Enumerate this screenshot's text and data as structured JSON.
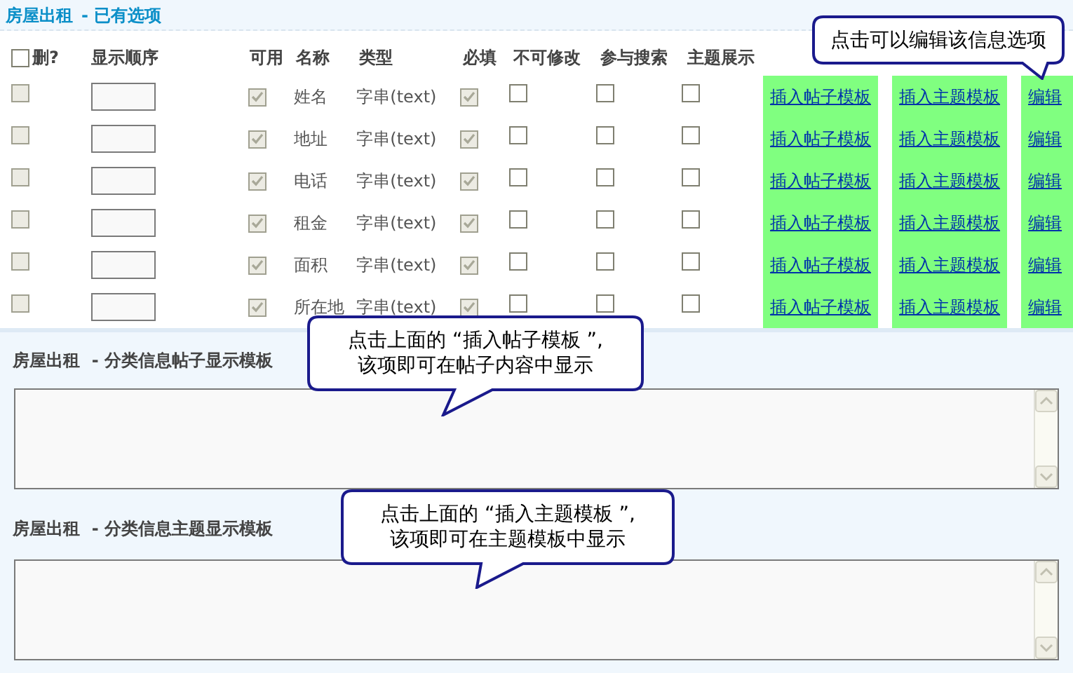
{
  "title": {
    "main": "房屋出租",
    "sub": "- 已有选项"
  },
  "columns": [
    "删?",
    "显示顺序",
    "可用",
    "名称",
    "类型",
    "必填",
    "不可修改",
    "参与搜索",
    "主题展示"
  ],
  "header_delete_checkbox": {
    "checked": false,
    "disabled": false
  },
  "rows": [
    {
      "delete": {
        "checked": false,
        "disabled": true
      },
      "enabled": {
        "checked": true,
        "disabled": true
      },
      "name": "姓名",
      "type": "字串(text)",
      "required": {
        "checked": true,
        "disabled": true
      },
      "readonly": {
        "checked": false,
        "disabled": false
      },
      "searchable": {
        "checked": false,
        "disabled": false
      },
      "show": {
        "checked": false,
        "disabled": false
      },
      "links": [
        "插入帖子模板",
        "插入主题模板",
        "编辑"
      ]
    },
    {
      "delete": {
        "checked": false,
        "disabled": true
      },
      "enabled": {
        "checked": true,
        "disabled": true
      },
      "name": "地址",
      "type": "字串(text)",
      "required": {
        "checked": true,
        "disabled": true
      },
      "readonly": {
        "checked": false,
        "disabled": false
      },
      "searchable": {
        "checked": false,
        "disabled": false
      },
      "show": {
        "checked": false,
        "disabled": false
      },
      "links": [
        "插入帖子模板",
        "插入主题模板",
        "编辑"
      ]
    },
    {
      "delete": {
        "checked": false,
        "disabled": true
      },
      "enabled": {
        "checked": true,
        "disabled": true
      },
      "name": "电话",
      "type": "字串(text)",
      "required": {
        "checked": true,
        "disabled": true
      },
      "readonly": {
        "checked": false,
        "disabled": false
      },
      "searchable": {
        "checked": false,
        "disabled": false
      },
      "show": {
        "checked": false,
        "disabled": false
      },
      "links": [
        "插入帖子模板",
        "插入主题模板",
        "编辑"
      ]
    },
    {
      "delete": {
        "checked": false,
        "disabled": true
      },
      "enabled": {
        "checked": true,
        "disabled": true
      },
      "name": "租金",
      "type": "字串(text)",
      "required": {
        "checked": true,
        "disabled": true
      },
      "readonly": {
        "checked": false,
        "disabled": false
      },
      "searchable": {
        "checked": false,
        "disabled": false
      },
      "show": {
        "checked": false,
        "disabled": false
      },
      "links": [
        "插入帖子模板",
        "插入主题模板",
        "编辑"
      ]
    },
    {
      "delete": {
        "checked": false,
        "disabled": true
      },
      "enabled": {
        "checked": true,
        "disabled": true
      },
      "name": "面积",
      "type": "字串(text)",
      "required": {
        "checked": true,
        "disabled": true
      },
      "readonly": {
        "checked": false,
        "disabled": false
      },
      "searchable": {
        "checked": false,
        "disabled": false
      },
      "show": {
        "checked": false,
        "disabled": false
      },
      "links": [
        "插入帖子模板",
        "插入主题模板",
        "编辑"
      ]
    },
    {
      "delete": {
        "checked": false,
        "disabled": true
      },
      "enabled": {
        "checked": true,
        "disabled": true
      },
      "name": "所在地",
      "type": "字串(text)",
      "required": {
        "checked": true,
        "disabled": true
      },
      "readonly": {
        "checked": false,
        "disabled": false
      },
      "searchable": {
        "checked": false,
        "disabled": false
      },
      "show": {
        "checked": false,
        "disabled": false
      },
      "links": [
        "插入帖子模板",
        "插入主题模板",
        "编辑"
      ]
    }
  ],
  "post_template": {
    "label": "房屋出租  - 分类信息帖子显示模板"
  },
  "thread_template": {
    "label": "房屋出租  - 分类信息主题显示模板"
  },
  "callouts": [
    {
      "kind": "edit",
      "lines": [
        "点击可以编辑该信息选项"
      ]
    },
    {
      "kind": "post",
      "lines": [
        "点击上面的 “插入帖子模板 ”,",
        "该项即可在帖子内容中显示"
      ]
    },
    {
      "kind": "thread",
      "lines": [
        "点击上面的 “插入主题模板 ”,",
        "该项即可在主题模板中显示"
      ]
    }
  ]
}
